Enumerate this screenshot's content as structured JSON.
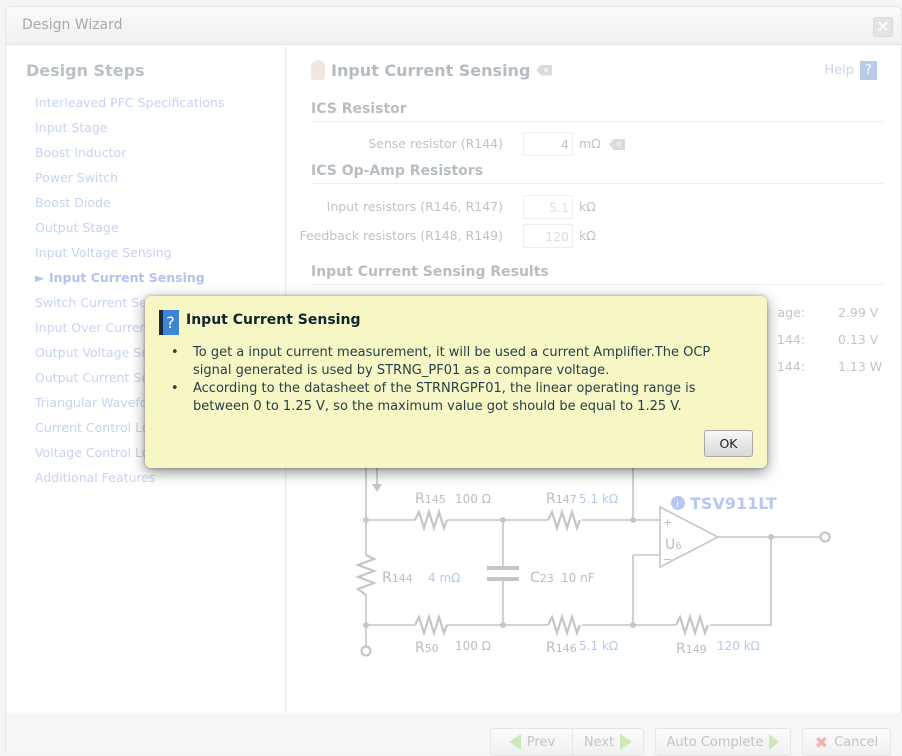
{
  "window": {
    "title": "Design Wizard",
    "close_icon": "close-icon"
  },
  "sidebar": {
    "title": "Design Steps",
    "items": [
      {
        "label": "Interleaved PFC Specifications"
      },
      {
        "label": "Input Stage"
      },
      {
        "label": "Boost Inductor"
      },
      {
        "label": "Power Switch"
      },
      {
        "label": "Boost Diode"
      },
      {
        "label": "Output Stage"
      },
      {
        "label": "Input Voltage Sensing"
      },
      {
        "label": "► Input Current Sensing",
        "active": true
      },
      {
        "label": "Switch Current Sensing"
      },
      {
        "label": "Input Over Current"
      },
      {
        "label": "Output Voltage Se"
      },
      {
        "label": "Output Current Se"
      },
      {
        "label": "Triangular Wavefo"
      },
      {
        "label": "Current Control Lo"
      },
      {
        "label": "Voltage Control Lo"
      },
      {
        "label": "Additional Features"
      }
    ]
  },
  "main": {
    "title": "Input Current Sensing",
    "help": "Help",
    "help_icon": "?",
    "sections": {
      "ics_resistor": "ICS Resistor",
      "opamp": "ICS Op-Amp Resistors",
      "results": "Input Current Sensing Results"
    },
    "fields": {
      "sense": {
        "label": "Sense resistor (R144)",
        "value": "4",
        "unit": "mΩ"
      },
      "input": {
        "label": "Input resistors (R146, R147)",
        "value": "5.1",
        "unit": "kΩ"
      },
      "feedback": {
        "label": "Feedback resistors (R148, R149)",
        "value": "120",
        "unit": "kΩ"
      }
    },
    "results": [
      {
        "label": "age:",
        "value": "2.99 V"
      },
      {
        "label": "144:",
        "value": "0.13 V"
      },
      {
        "label": "144:",
        "value": "1.13 W"
      }
    ],
    "circuit": {
      "r145": {
        "name": "R",
        "sub": "145",
        "value": "100 Ω"
      },
      "r147": {
        "name": "R",
        "sub": "147",
        "value": "5.1 kΩ"
      },
      "r144": {
        "name": "R",
        "sub": "144",
        "value": "4 mΩ"
      },
      "c23": {
        "name": "C",
        "sub": "23",
        "value": "10 nF"
      },
      "r50": {
        "name": "R",
        "sub": "50",
        "value": "100 Ω"
      },
      "r146": {
        "name": "R",
        "sub": "146",
        "value": "5.1 kΩ"
      },
      "r149": {
        "name": "R",
        "sub": "149",
        "value": "120 kΩ"
      },
      "opamp": {
        "part": "TSV911LT",
        "ref": "U",
        "sub": "6",
        "plus": "+",
        "minus": "−"
      }
    }
  },
  "footer": {
    "prev": "Prev",
    "next": "Next",
    "auto": "Auto Complete",
    "cancel": "Cancel"
  },
  "dialog": {
    "title": "Input Current Sensing",
    "icon": "?",
    "bullets": [
      "To get a input current measurement, it will be used a current Amplifier.The OCP signal generated is used by STRNG_PF01 as a compare voltage.",
      "According to the datasheet of the STRNRGPF01, the linear operating range is between 0 to 1.25 V, so the maximum value got should be equal to 1.25 V."
    ],
    "ok": "OK"
  },
  "colors": {
    "accent_blue": "#3d86d6",
    "dialog_bg": "#f7f6c5",
    "link": "#c6d3ef"
  }
}
